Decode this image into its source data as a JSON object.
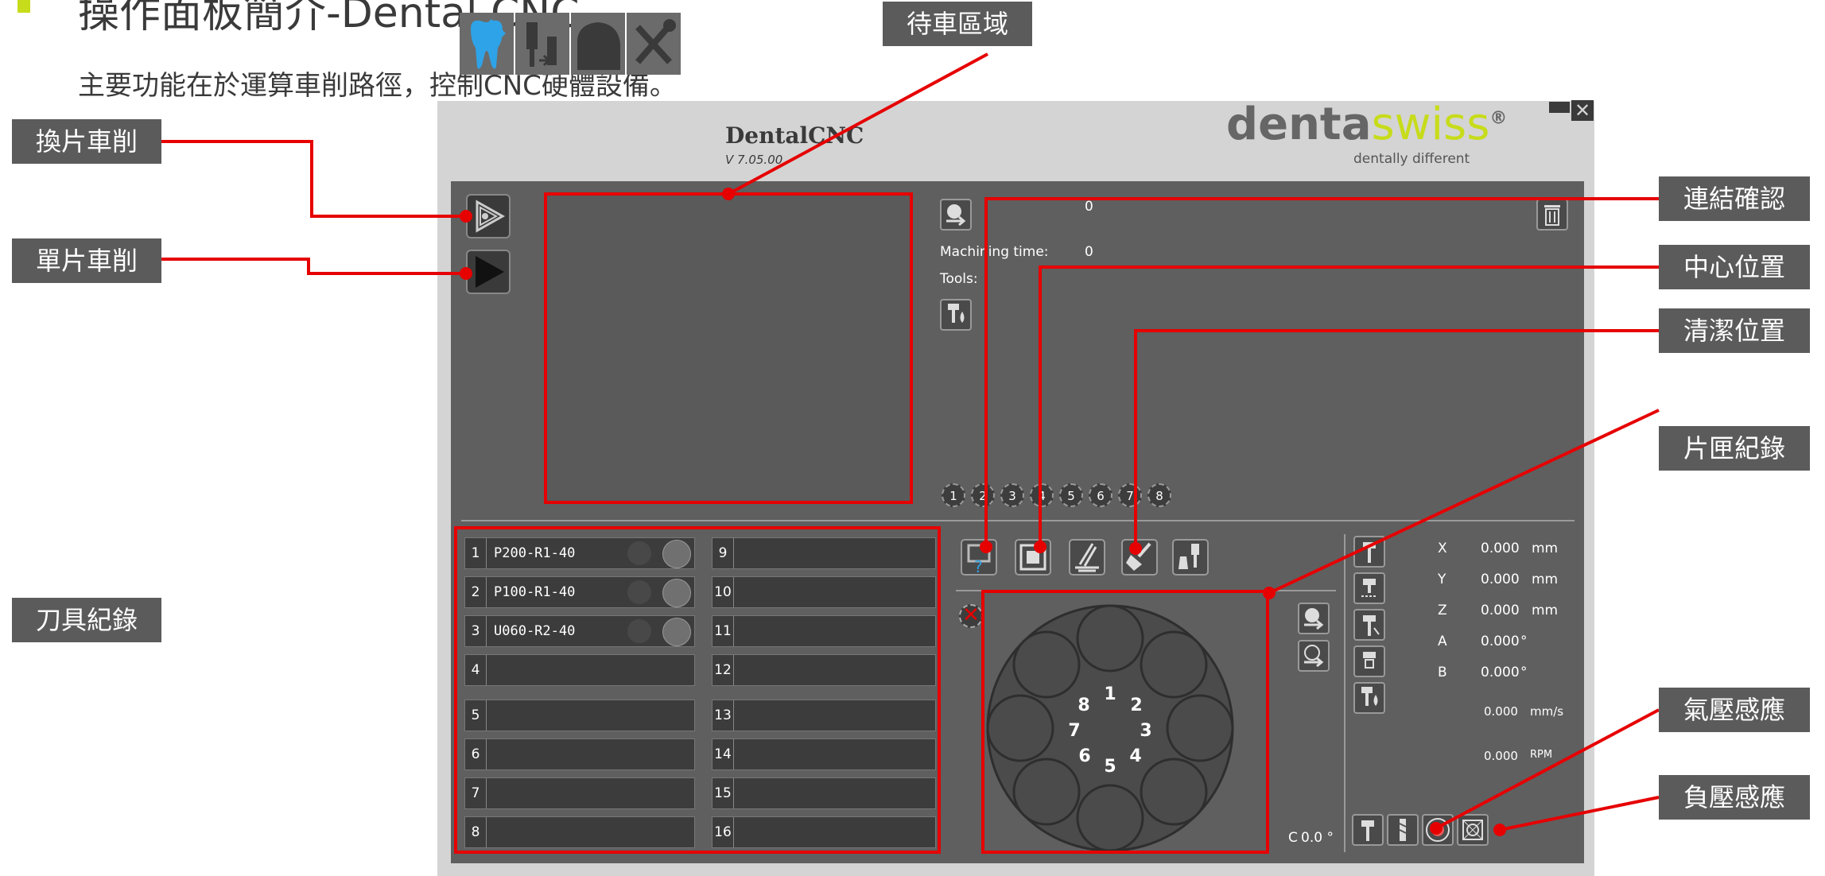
{
  "slide": {
    "title": "操作面板簡介-Dental CNC",
    "subtitle": "主要功能在於運算車削路徑，控制CNC硬體設備。"
  },
  "callouts": {
    "waiting_area": "待車區域",
    "change_piece": "換片車削",
    "single_piece": "單片車削",
    "tool_record": "刀具紀錄",
    "connection_check": "連結確認",
    "center_position": "中心位置",
    "cleaning_position": "清潔位置",
    "magazine_record": "片匣紀錄",
    "air_pressure": "氣壓感應",
    "negative_pressure": "負壓感應"
  },
  "app": {
    "name": "DentalCNC",
    "version": "V 7.05.00",
    "brand_denta": "denta",
    "brand_swiss": "swiss",
    "brand_reg": "®",
    "brand_tagline": "dentally different",
    "accent_color": "#c7dc1a",
    "job": {
      "count": "0",
      "machining_time_label": "Machining time:",
      "machining_time_value": "0",
      "tools_label": "Tools:"
    },
    "magazine_tabs": [
      "1",
      "2",
      "3",
      "4",
      "5",
      "6",
      "7",
      "8"
    ],
    "tools": [
      {
        "num": "1",
        "name": "P200-R1-40"
      },
      {
        "num": "2",
        "name": "P100-R1-40"
      },
      {
        "num": "3",
        "name": "U060-R2-40"
      },
      {
        "num": "4",
        "name": ""
      },
      {
        "num": "5",
        "name": ""
      },
      {
        "num": "6",
        "name": ""
      },
      {
        "num": "7",
        "name": ""
      },
      {
        "num": "8",
        "name": ""
      },
      {
        "num": "9",
        "name": ""
      },
      {
        "num": "10",
        "name": ""
      },
      {
        "num": "11",
        "name": ""
      },
      {
        "num": "12",
        "name": ""
      },
      {
        "num": "13",
        "name": ""
      },
      {
        "num": "14",
        "name": ""
      },
      {
        "num": "15",
        "name": ""
      },
      {
        "num": "16",
        "name": ""
      }
    ],
    "carousel": [
      "1",
      "2",
      "3",
      "4",
      "5",
      "6",
      "7",
      "8"
    ],
    "c_axis_label": "C",
    "c_axis_value": "0.0 °",
    "coords": [
      {
        "axis": "X",
        "value": "0.000",
        "unit": "mm"
      },
      {
        "axis": "Y",
        "value": "0.000",
        "unit": "mm"
      },
      {
        "axis": "Z",
        "value": "0.000",
        "unit": "mm"
      },
      {
        "axis": "A",
        "value": "0.000",
        "unit": "°"
      },
      {
        "axis": "B",
        "value": "0.000",
        "unit": "°"
      }
    ],
    "feed": {
      "value": "0.000",
      "unit": "mm/s"
    },
    "spindle": {
      "value": "0.000",
      "unit": "RPM"
    }
  }
}
